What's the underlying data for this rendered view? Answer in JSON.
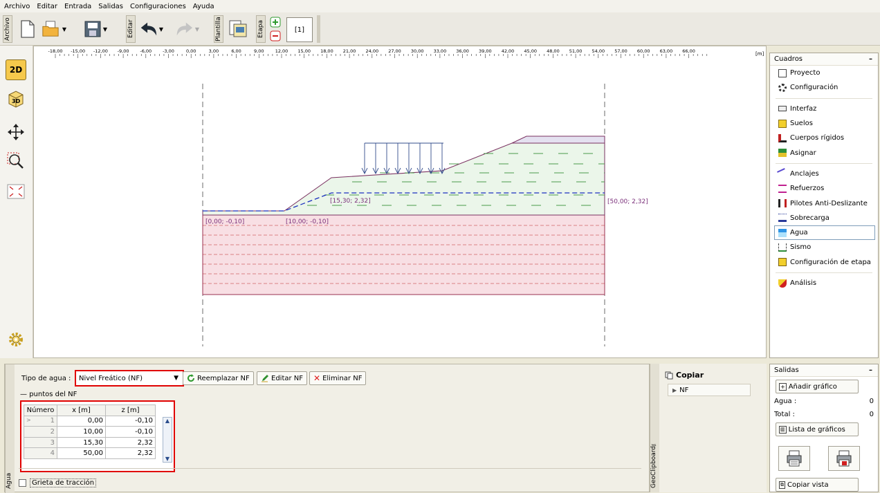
{
  "menu": [
    "Archivo",
    "Editar",
    "Entrada",
    "Salidas",
    "Configuraciones",
    "Ayuda"
  ],
  "toolbar": {
    "archivo_tab": "Archivo",
    "editar_tab": "Editar",
    "plantilla_tab": "Plantilla",
    "etapa_tab": "Etapa",
    "stage_label": "[1]"
  },
  "left_tools": {
    "view2d": "2D",
    "view3d": "3D"
  },
  "ruler": {
    "ticks": [
      "-18,00",
      "-15,00",
      "-12,00",
      "-9,00",
      "-6,00",
      "-3,00",
      "0,00",
      "3,00",
      "6,00",
      "9,00",
      "12,00",
      "15,00",
      "18,00",
      "21,00",
      "24,00",
      "27,00",
      "30,00",
      "33,00",
      "36,00",
      "39,00",
      "42,00",
      "45,00",
      "48,00",
      "51,00",
      "54,00",
      "57,00",
      "60,00",
      "63,00",
      "66,00"
    ],
    "unit": "[m]"
  },
  "canvas_labels": {
    "p1": "[0,00; -0,10]",
    "p2": "[10,00; -0,10]",
    "p3": "[15,30; 2,32]",
    "p4": "[50,00; 2,32]"
  },
  "cuadros": {
    "title": "Cuadros",
    "items": [
      {
        "label": "Proyecto",
        "icon": "document-icon"
      },
      {
        "label": "Configuración",
        "icon": "gear-icon"
      },
      {
        "label": "Interfaz",
        "icon": "interface-icon"
      },
      {
        "label": "Suelos",
        "icon": "soil-icon"
      },
      {
        "label": "Cuerpos rígidos",
        "icon": "rigid-body-icon"
      },
      {
        "label": "Asignar",
        "icon": "assign-icon"
      },
      {
        "label": "Anclajes",
        "icon": "anchor-icon"
      },
      {
        "label": "Refuerzos",
        "icon": "reinforcement-icon"
      },
      {
        "label": "Pilotes Anti-Deslizante",
        "icon": "pile-icon"
      },
      {
        "label": "Sobrecarga",
        "icon": "surcharge-icon"
      },
      {
        "label": "Agua",
        "icon": "water-icon"
      },
      {
        "label": "Sismo",
        "icon": "earthquake-icon"
      },
      {
        "label": "Configuración de etapa",
        "icon": "stage-settings-icon"
      },
      {
        "label": "Análisis",
        "icon": "analysis-icon"
      }
    ]
  },
  "water": {
    "type_label": "Tipo de agua :",
    "type_value": "Nivel Freático (NF)",
    "replace_btn": "Reemplazar NF",
    "edit_btn": "Editar NF",
    "delete_btn": "Eliminar NF",
    "points_group": "puntos del NF",
    "columns": [
      "Número",
      "x [m]",
      "z [m]"
    ],
    "rows": [
      {
        "n": "1",
        "x": "0,00",
        "z": "-0,10"
      },
      {
        "n": "2",
        "x": "10,00",
        "z": "-0,10"
      },
      {
        "n": "3",
        "x": "15,30",
        "z": "2,32"
      },
      {
        "n": "4",
        "x": "50,00",
        "z": "2,32"
      }
    ],
    "crack_label": "Grieta de tracción",
    "side_tab": "Agua"
  },
  "clipboard": {
    "copy_label": "Copiar",
    "item": "NF",
    "side_tab": "GeoClipboard™"
  },
  "outputs": {
    "title": "Salidas",
    "add_chart": "Añadir gráfico",
    "agua_label": "Agua :",
    "agua_value": "0",
    "total_label": "Total :",
    "total_value": "0",
    "list_charts": "Lista de gráficos",
    "copy_view": "Copiar vista"
  }
}
